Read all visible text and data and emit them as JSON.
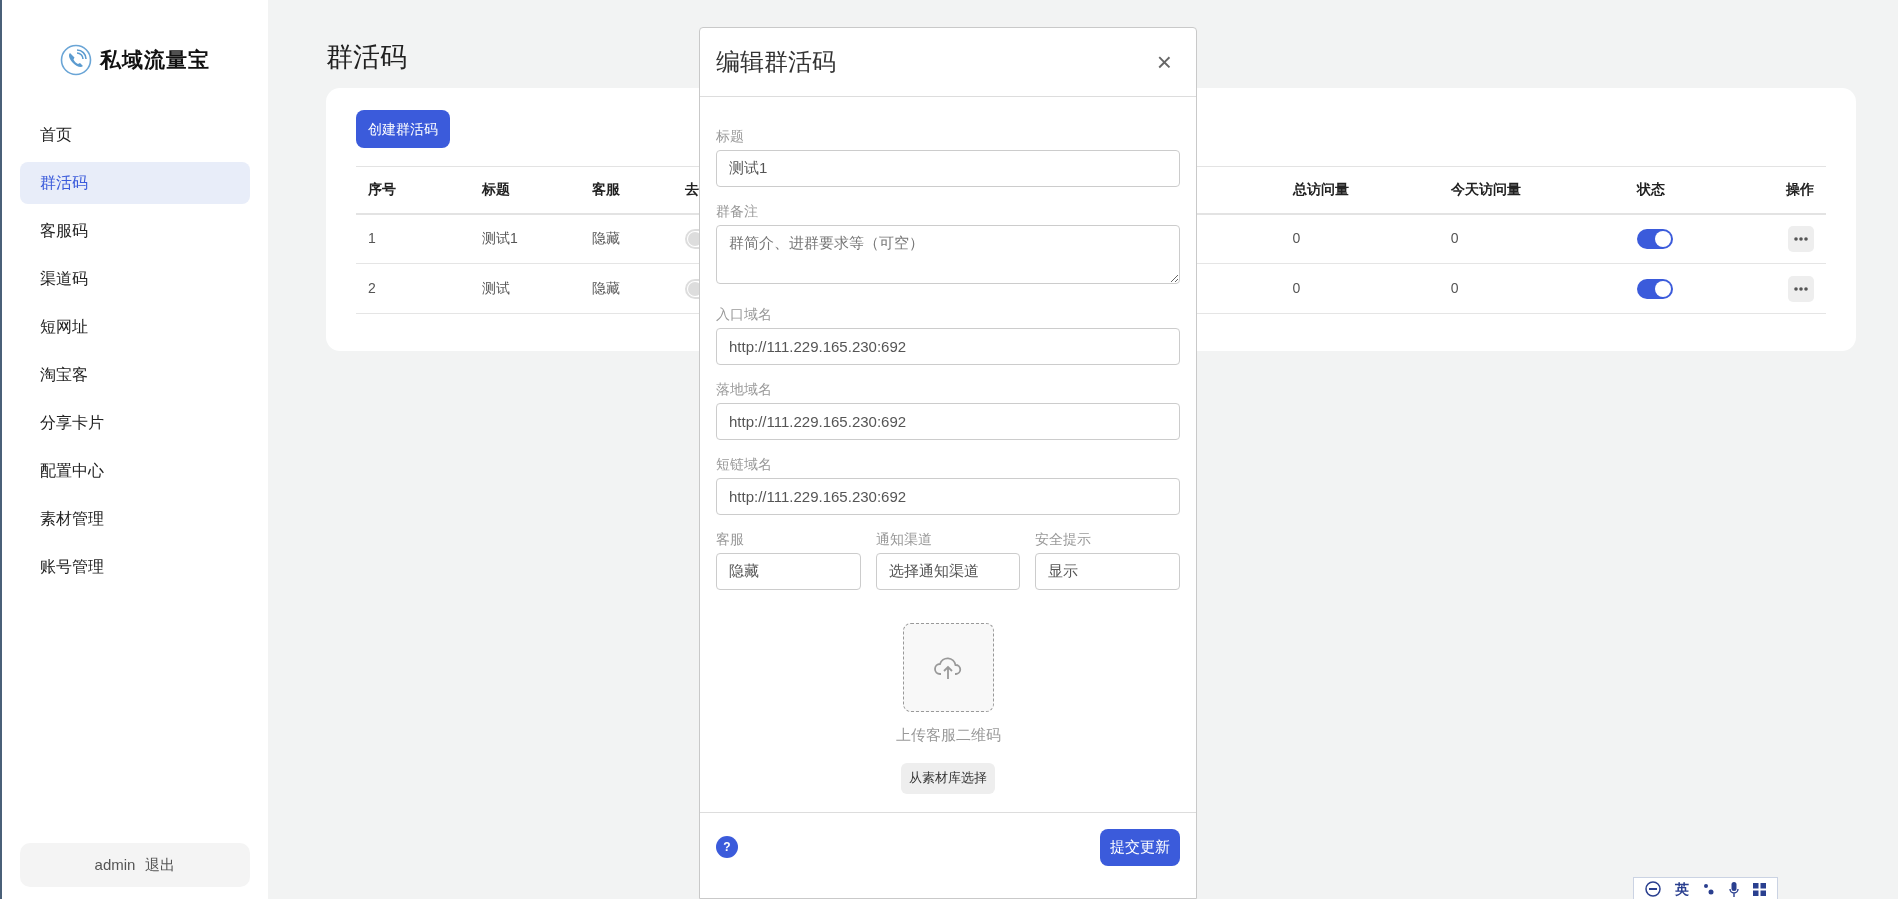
{
  "sidebar": {
    "logo_text": "私域流量宝",
    "items": [
      {
        "label": "首页",
        "selected": false
      },
      {
        "label": "群活码",
        "selected": true
      },
      {
        "label": "客服码",
        "selected": false
      },
      {
        "label": "渠道码",
        "selected": false
      },
      {
        "label": "短网址",
        "selected": false
      },
      {
        "label": "淘宝客",
        "selected": false
      },
      {
        "label": "分享卡片",
        "selected": false
      },
      {
        "label": "配置中心",
        "selected": false
      },
      {
        "label": "素材管理",
        "selected": false
      },
      {
        "label": "账号管理",
        "selected": false
      }
    ],
    "user": {
      "name": "admin",
      "logout": "退出"
    }
  },
  "page": {
    "title": "群活码",
    "create_button": "创建群活码"
  },
  "table": {
    "columns": [
      "序号",
      "标题",
      "客服",
      "去",
      "总访问量",
      "今天访问量",
      "状态",
      "操作"
    ],
    "rows": [
      {
        "index": "1",
        "title": "测试1",
        "service": "隐藏",
        "column_4_on": false,
        "total": "0",
        "today": "0",
        "status_on": true
      },
      {
        "index": "2",
        "title": "测试",
        "service": "隐藏",
        "column_4_on": false,
        "total": "0",
        "today": "0",
        "status_on": true
      }
    ]
  },
  "modal": {
    "title": "编辑群活码",
    "close": "×",
    "fields": [
      {
        "kind": "input",
        "label": "标题",
        "value": "测试1"
      },
      {
        "kind": "textarea",
        "label": "群备注",
        "placeholder": "群简介、进群要求等（可空）"
      },
      {
        "kind": "input",
        "label": "入口域名",
        "value": "http://111.229.165.230:692"
      },
      {
        "kind": "input",
        "label": "落地域名",
        "value": "http://111.229.165.230:692"
      },
      {
        "kind": "input",
        "label": "短链域名",
        "value": "http://111.229.165.230:692"
      }
    ],
    "row_fields": [
      {
        "label": "客服",
        "value": "隐藏"
      },
      {
        "label": "通知渠道",
        "value": "选择通知渠道"
      },
      {
        "label": "安全提示",
        "value": "显示"
      }
    ],
    "upload": {
      "label": "上传客服二维码",
      "library_button": "从素材库选择"
    },
    "help": "?",
    "submit": "提交更新"
  },
  "ime_toolbar": {
    "mode": "英"
  }
}
